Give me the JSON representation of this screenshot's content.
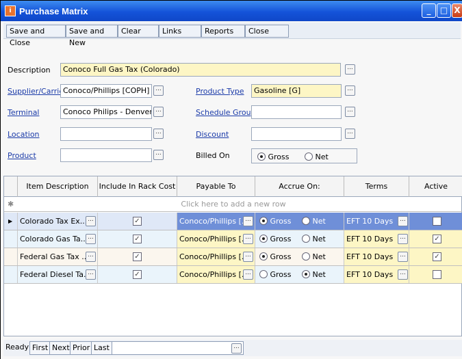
{
  "window": {
    "title": "Purchase Matrix"
  },
  "toolbar": {
    "save_close": "Save and Close",
    "save_new": "Save and New",
    "clear": "Clear",
    "links": "Links",
    "reports": "Reports",
    "close": "Close"
  },
  "form": {
    "description_label": "Description",
    "description_value": "Conoco Full Gas Tax (Colorado)",
    "supplier_label": "Supplier/Carrier",
    "supplier_value": "Conoco/Phillips [COPH]",
    "terminal_label": "Terminal",
    "terminal_value": "Conoco Philips - Denver [CPI",
    "location_label": "Location",
    "location_value": "",
    "product_label": "Product",
    "product_value": "",
    "product_type_label": "Product Type",
    "product_type_value": "Gasoline [G]",
    "schedule_group_label": "Schedule Group",
    "schedule_group_value": "",
    "discount_label": "Discount",
    "discount_value": "",
    "billed_on_label": "Billed On",
    "billed_on_gross": "Gross",
    "billed_on_net": "Net",
    "billed_on_selected": "Gross"
  },
  "grid": {
    "headers": [
      "Item Description",
      "Include In Rack Cost",
      "Payable To",
      "Accrue On:",
      "Terms",
      "Active"
    ],
    "add_row_text": "Click here to add a new row",
    "rows": [
      {
        "item": "Colorado Tax Ex...",
        "include": true,
        "payable": "Conoco/Phillips [...",
        "accrue": "Gross",
        "terms": "EFT 10 Days",
        "active": false
      },
      {
        "item": "Colorado Gas Ta...",
        "include": true,
        "payable": "Conoco/Phillips [...",
        "accrue": "Gross",
        "terms": "EFT 10 Days",
        "active": true
      },
      {
        "item": "Federal Gas Tax ...",
        "include": true,
        "payable": "Conoco/Phillips [...",
        "accrue": "Gross",
        "terms": "EFT 10 Days",
        "active": true
      },
      {
        "item": "Federal Diesel Ta...",
        "include": true,
        "payable": "Conoco/Phillips [...",
        "accrue": "Net",
        "terms": "EFT 10 Days",
        "active": false
      }
    ],
    "gross_label": "Gross",
    "net_label": "Net"
  },
  "status": {
    "ready": "Ready",
    "first": "First",
    "next": "Next",
    "prior": "Prior",
    "last": "Last"
  }
}
